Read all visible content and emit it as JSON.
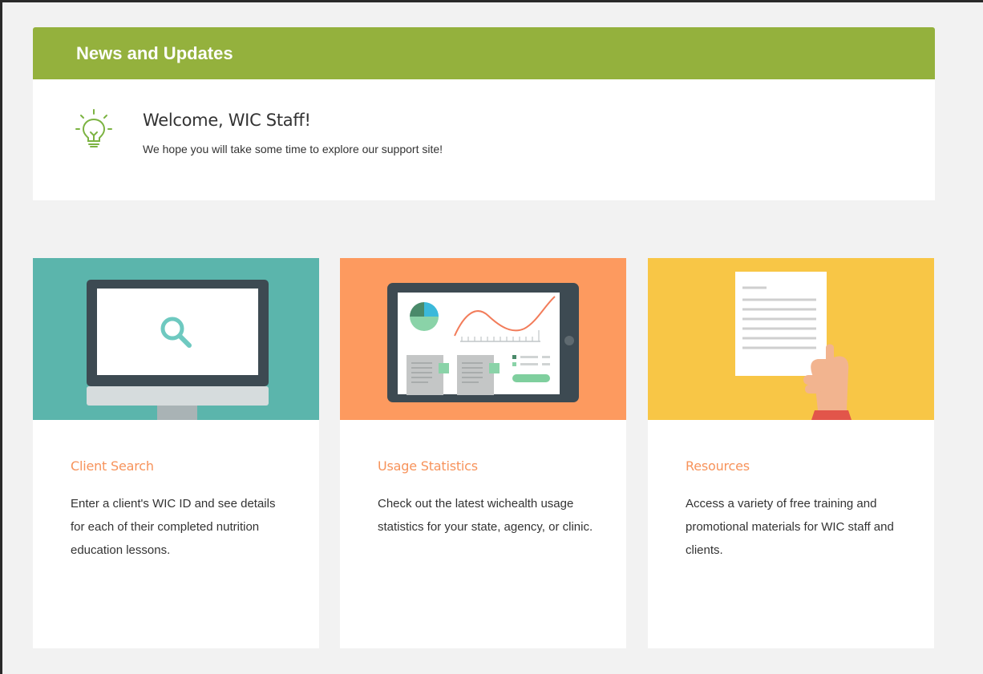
{
  "news": {
    "title": "News and Updates",
    "welcome_title": "Welcome, WIC Staff!",
    "welcome_text": "We hope you will take some time to explore our support site!",
    "icon": "lightbulb-icon"
  },
  "colors": {
    "header_green": "#94b13d",
    "card_title_orange": "#f7935b",
    "teal": "#5bb5ac",
    "orange": "#fd9a5f",
    "yellow": "#f8c646"
  },
  "cards": [
    {
      "title": "Client Search",
      "description": "Enter a client's WIC ID and see details for each of their completed nutrition education lessons.",
      "illustration": "monitor-search-illustration"
    },
    {
      "title": "Usage Statistics",
      "description": "Check out the latest wichealth usage statistics for your state, agency, or clinic.",
      "illustration": "tablet-statistics-illustration"
    },
    {
      "title": "Resources",
      "description": "Access a variety of free training and promotional materials for WIC staff and clients.",
      "illustration": "document-hand-illustration"
    }
  ]
}
